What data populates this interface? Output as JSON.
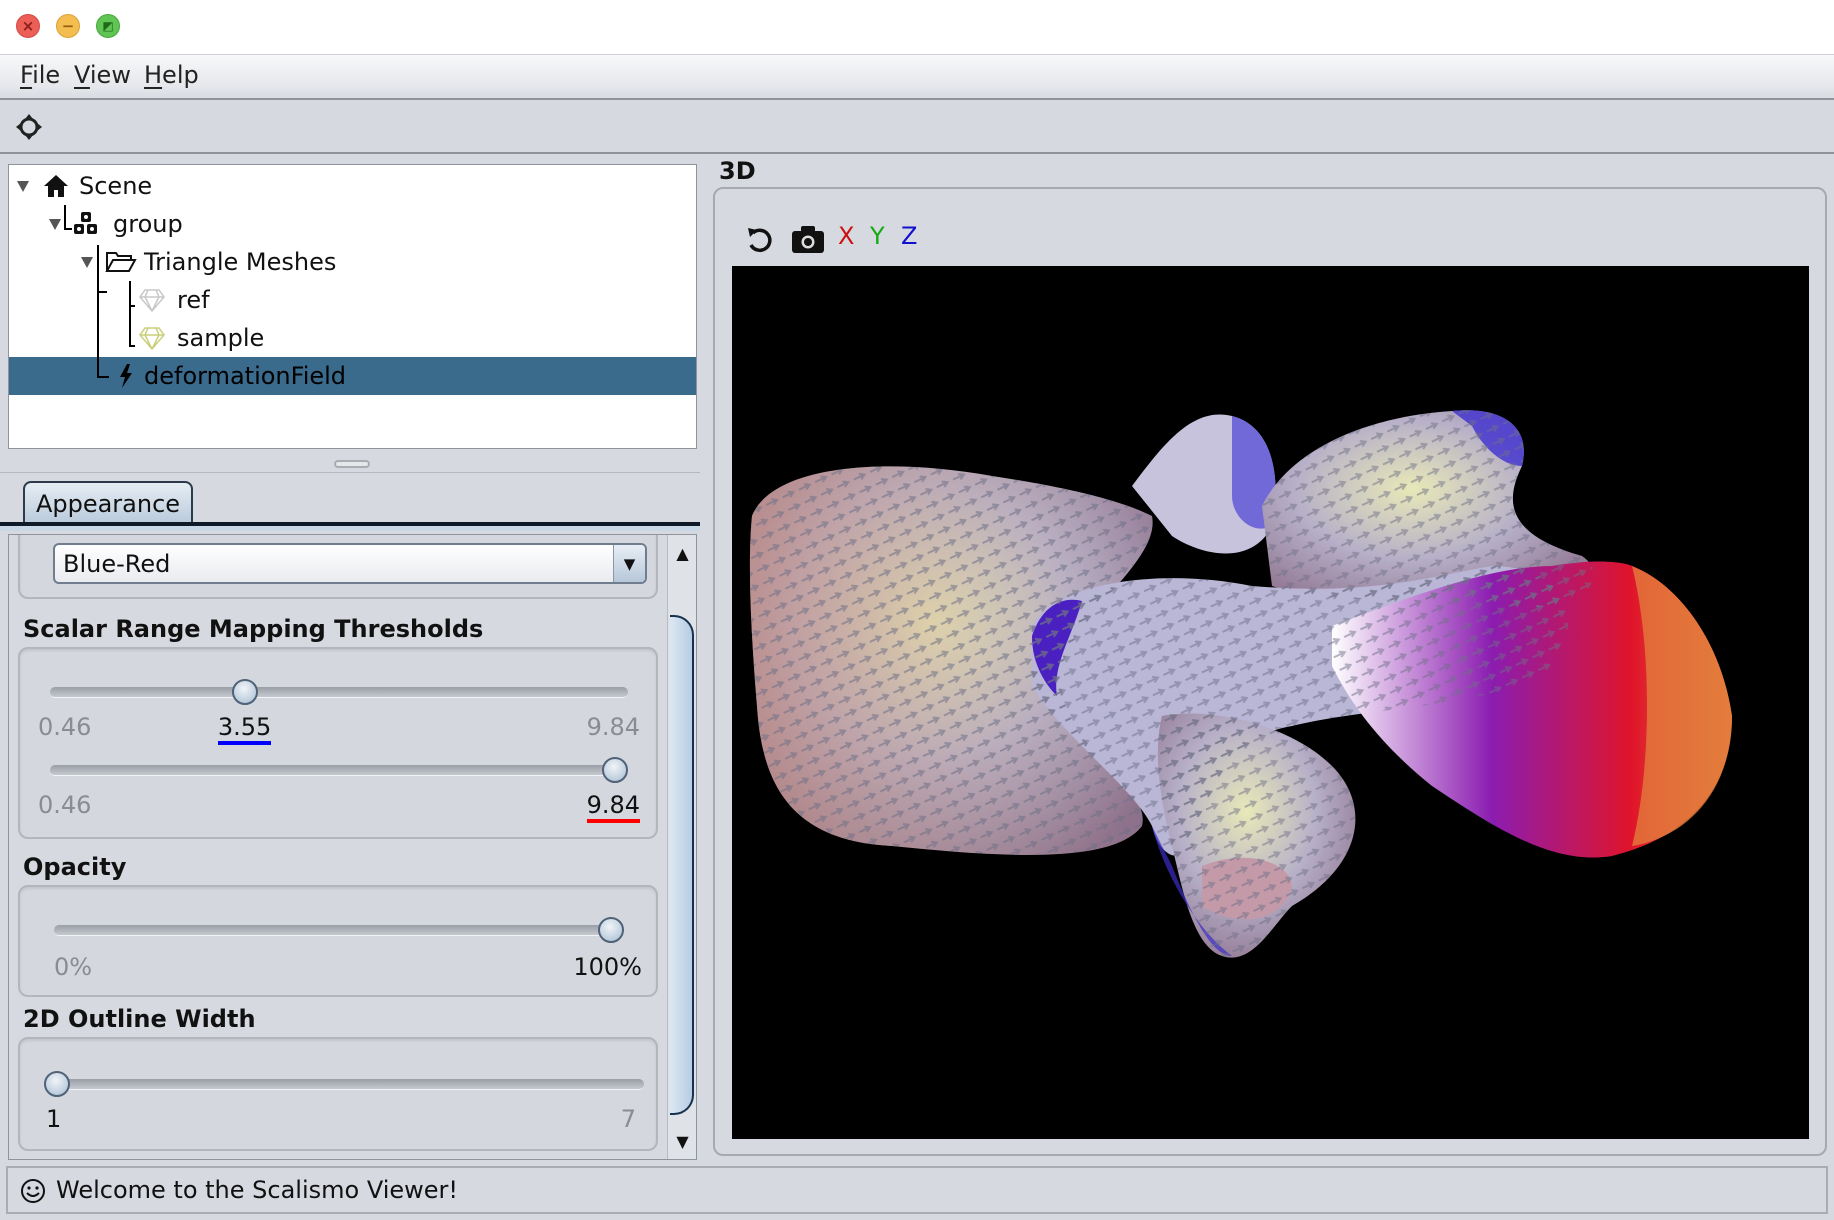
{
  "window": {
    "controls": [
      "close",
      "minimize",
      "maximize"
    ]
  },
  "menu": {
    "items": [
      {
        "label": "File",
        "mnemonic": "F",
        "rest": "ile"
      },
      {
        "label": "View",
        "mnemonic": "V",
        "rest": "iew"
      },
      {
        "label": "Help",
        "mnemonic": "H",
        "rest": "elp"
      }
    ]
  },
  "toolbar": {
    "tools": [
      {
        "icon": "move-crosshair-icon"
      }
    ]
  },
  "tree": {
    "nodes": [
      {
        "label": "Scene",
        "icon": "home-icon",
        "level": 0,
        "expanded": true
      },
      {
        "label": "group",
        "icon": "group-icon",
        "level": 1,
        "expanded": true
      },
      {
        "label": "Triangle Meshes",
        "icon": "folder-icon",
        "level": 2,
        "expanded": true
      },
      {
        "label": "ref",
        "icon": "mesh-icon",
        "level": 3,
        "icon_color": "#c8c8c8"
      },
      {
        "label": "sample",
        "icon": "mesh-icon",
        "level": 3,
        "icon_color": "#c9cf7a"
      },
      {
        "label": "deformationField",
        "icon": "lightning-icon",
        "level": 2,
        "selected": true
      }
    ],
    "selection_color": "#3a6a8c"
  },
  "properties": {
    "tabs": [
      {
        "label": "Appearance",
        "active": true
      }
    ],
    "colormap": {
      "value": "Blue-Red"
    },
    "scalar_range": {
      "title": "Scalar Range Mapping Thresholds",
      "lower": {
        "min": "0.46",
        "max": "9.84",
        "value": "3.55",
        "value_num": 3.55,
        "underline_color": "#0000ff"
      },
      "upper": {
        "min": "0.46",
        "max": "9.84",
        "value": "9.84",
        "value_num": 9.84,
        "underline_color": "#ff0000"
      },
      "range_min": 0.46,
      "range_max": 9.84
    },
    "opacity": {
      "title": "Opacity",
      "min_label": "0%",
      "max_label": "100%",
      "value_percent": 100
    },
    "outline_width": {
      "title": "2D Outline Width",
      "min_label": "1",
      "max_label": "7",
      "value": 1,
      "min": 1,
      "max": 7
    }
  },
  "viewport": {
    "title": "3D",
    "toolbar": {
      "reset_icon": "reset-rotation-icon",
      "screenshot_icon": "camera-icon",
      "axes": [
        {
          "label": "X",
          "color": "#cc1111"
        },
        {
          "label": "Y",
          "color": "#11aa11"
        },
        {
          "label": "Z",
          "color": "#1111cc"
        }
      ]
    },
    "scene_description": "Vertebra mesh rendered with deformation field arrows colored blue to red"
  },
  "status": {
    "icon": "smiley-icon",
    "message": "Welcome to the Scalismo Viewer!"
  }
}
